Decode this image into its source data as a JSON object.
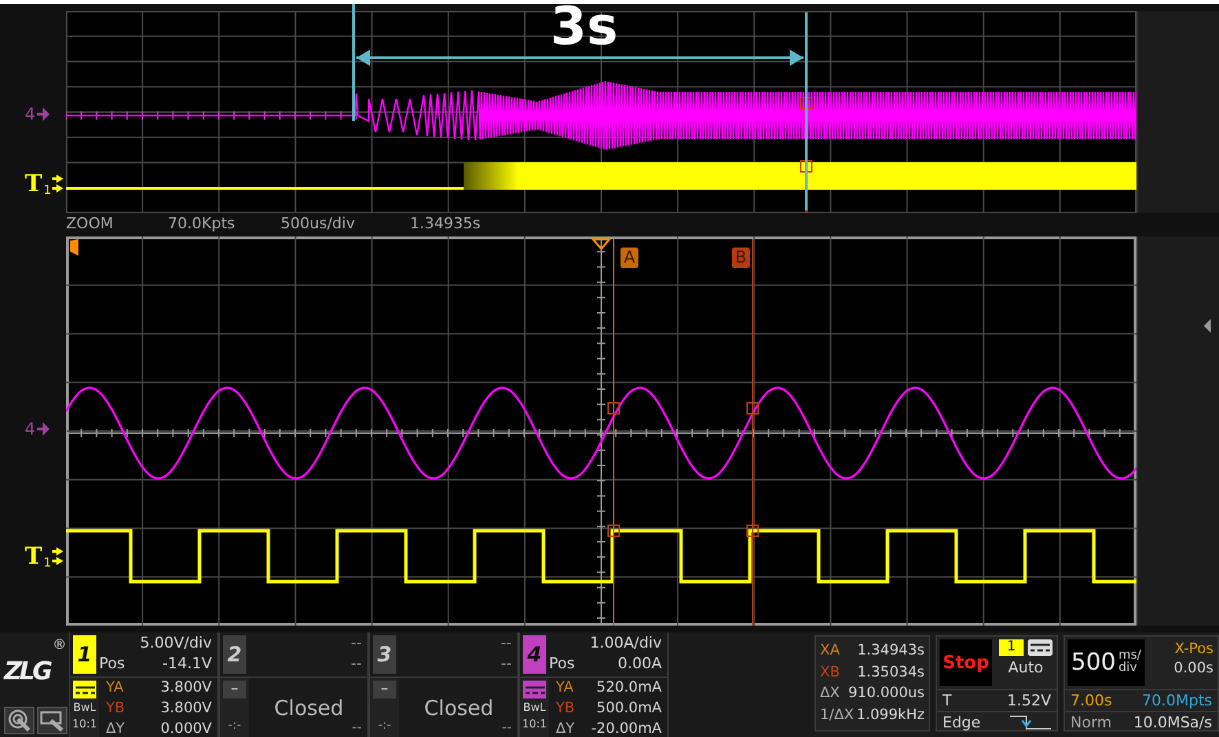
{
  "annotation": {
    "text": "3s"
  },
  "overview": {
    "channel_marker": "4",
    "trigger_marker": {
      "letter": "T",
      "channel": "1"
    }
  },
  "zoom_info": [
    "ZOOM",
    "70.0Kpts",
    "500us/div",
    "1.34935s"
  ],
  "main": {
    "channel_marker": "4",
    "trigger_marker": {
      "letter": "T",
      "channel": "1"
    },
    "cursors": [
      {
        "label": "A",
        "color": "#c86a00"
      },
      {
        "label": "B",
        "color": "#b83a10"
      }
    ]
  },
  "brand": {
    "logo": "ZLG",
    "mark": "®"
  },
  "channels": [
    {
      "kind": "active",
      "number": "1",
      "color": "#ffff00",
      "scale": "5.00V/div",
      "pos_label": "Pos",
      "pos": "-14.1V",
      "bwl": "BwL",
      "probe": "10:1",
      "readouts": [
        {
          "label": "YA",
          "value": "3.800V",
          "color": "#d08020"
        },
        {
          "label": "YB",
          "value": "3.800V",
          "color": "#c84010"
        },
        {
          "label": "ΔY",
          "value": "0.000V",
          "color": "#b0b0b0"
        }
      ]
    },
    {
      "kind": "closed",
      "number": "2",
      "top": "--",
      "second": "--",
      "minus": "–",
      "status": "Closed",
      "bottom_left": "-:-",
      "bottom_right": "--"
    },
    {
      "kind": "closed",
      "number": "3",
      "top": "--",
      "second": "--",
      "minus": "–",
      "status": "Closed",
      "bottom_left": "-:-",
      "bottom_right": "--"
    },
    {
      "kind": "active",
      "number": "4",
      "color": "#c040c0",
      "scale": "1.00A/div",
      "pos_label": "Pos",
      "pos": "0.00A",
      "bwl": "BwL",
      "probe": "10:1",
      "readouts": [
        {
          "label": "YA",
          "value": "520.0mA",
          "color": "#d08020"
        },
        {
          "label": "YB",
          "value": "500.0mA",
          "color": "#c84010"
        },
        {
          "label": "ΔY",
          "value": "-20.00mA",
          "color": "#b0b0b0"
        }
      ]
    }
  ],
  "cursor_readout": [
    {
      "label": "XA",
      "value": "1.34943s",
      "color": "#d08020"
    },
    {
      "label": "XB",
      "value": "1.35034s",
      "color": "#c84010"
    },
    {
      "label": "ΔX",
      "value": "910.000us",
      "color": "#b0b0b0"
    },
    {
      "label": "1/ΔX",
      "value": "1.099kHz",
      "color": "#b0b0b0"
    }
  ],
  "trigger": {
    "state": "Stop",
    "source": "1",
    "mode": "Auto",
    "level_label": "T",
    "level": "1.52V",
    "type": "Edge"
  },
  "timebase": {
    "value": "500",
    "unit_top": "ms/",
    "unit_bottom": "div",
    "xpos_label": "X-Pos",
    "xpos": "0.00s",
    "duration": "7.00s",
    "points": "70.0Mpts",
    "acq": "Norm",
    "rate": "10.0MSa/s"
  }
}
